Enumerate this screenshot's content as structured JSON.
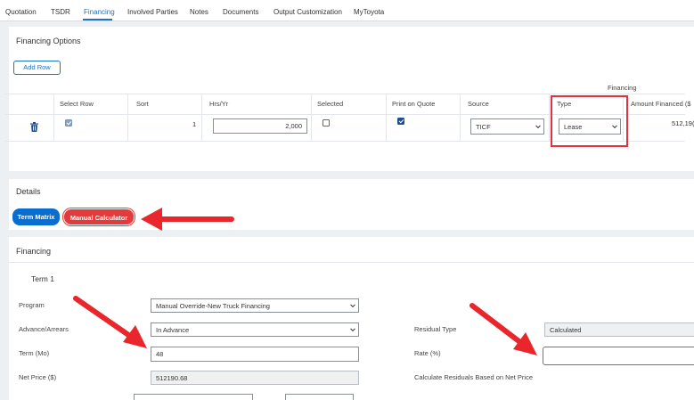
{
  "nav": {
    "tabs": [
      {
        "label": "Quotation"
      },
      {
        "label": "TSDR"
      },
      {
        "label": "Financing"
      },
      {
        "label": "Involved Parties"
      },
      {
        "label": "Notes"
      },
      {
        "label": "Documents"
      },
      {
        "label": "Output Customization"
      },
      {
        "label": "MyToyota"
      }
    ],
    "active": "Financing"
  },
  "financing_options": {
    "title": "Financing Options",
    "add_row_label": "Add Row",
    "group_header": "Financing",
    "columns": [
      "Select Row",
      "Sort",
      "Hrs/Yr",
      "Selected",
      "Print on Quote",
      "Source",
      "Type",
      "Amount Financed ($"
    ],
    "row": {
      "select_row": true,
      "sort": "1",
      "hrs_yr": "2,000",
      "selected": false,
      "print_on_quote": true,
      "source": "TICF",
      "type": "Lease",
      "amount_financed": "512,19("
    }
  },
  "details": {
    "title": "Details",
    "term_matrix_label": "Term Matrix",
    "manual_calculator_label": "Manual Calculator"
  },
  "financing": {
    "title": "Financing",
    "term_title": "Term 1",
    "fields": {
      "program": {
        "label": "Program",
        "value": "Manual Override-New Truck Financing"
      },
      "advance_arrears": {
        "label": "Advance/Arrears",
        "value": "In Advance"
      },
      "term": {
        "label": "Term (Mo)",
        "value": "48"
      },
      "net_price": {
        "label": "Net Price ($)",
        "value": "512190.68"
      },
      "residual_type": {
        "label": "Residual Type",
        "value": "Calculated"
      },
      "rate": {
        "label": "Rate (%)",
        "value": ""
      },
      "calc_residuals_label": "Calculate Residuals Based on Net Price"
    }
  },
  "colors": {
    "accent": "#1a73c9",
    "button_blue": "#0a6ed1",
    "highlight_red": "#e2323f",
    "arrow_red": "#e8262b"
  },
  "icons": {
    "delete": "trash-icon",
    "dropdown": "chevron-down-icon",
    "annotation": "red-arrow"
  }
}
